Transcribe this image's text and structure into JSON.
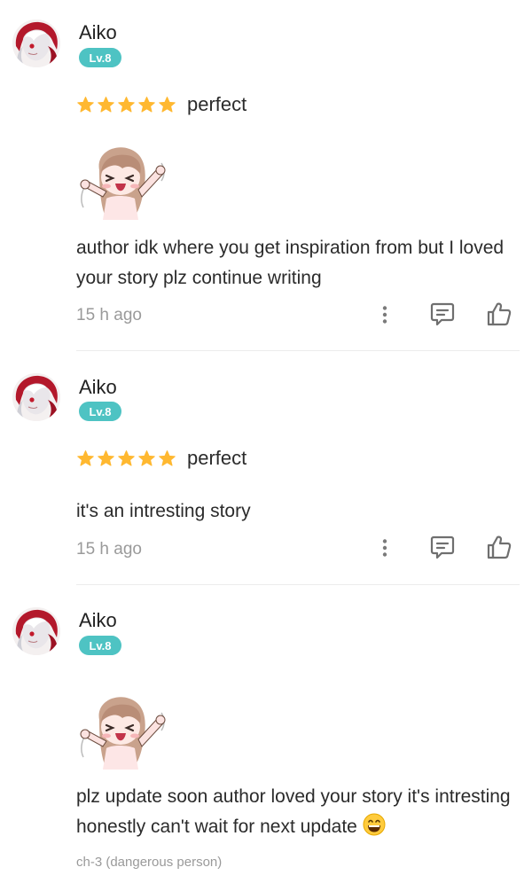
{
  "comments": [
    {
      "username": "Aiko",
      "level": "Lv.8",
      "rating_text": "perfect",
      "stars": 5,
      "has_sticker": true,
      "text": "author idk where you get inspiration from but I loved your story plz continue writing",
      "timestamp": "15 h ago"
    },
    {
      "username": "Aiko",
      "level": "Lv.8",
      "rating_text": "perfect",
      "stars": 5,
      "has_sticker": false,
      "text": "it's an intresting story",
      "timestamp": "15 h ago"
    },
    {
      "username": "Aiko",
      "level": "Lv.8",
      "has_sticker": true,
      "text": "plz update soon author loved your story it's intresting honestly can't wait for next update",
      "chapter_ref": "ch-3 (dangerous person)"
    }
  ],
  "icons": {
    "more": "more-vertical-icon",
    "reply": "reply-comment-icon",
    "like": "thumbs-up-icon",
    "star": "star-icon",
    "emoji": "grinning-face-icon"
  },
  "colors": {
    "badge": "#4ec3c3",
    "star": "#ffb830",
    "text": "#2b2b2b",
    "muted": "#9a9a9a",
    "icon": "#6f6f6f"
  }
}
